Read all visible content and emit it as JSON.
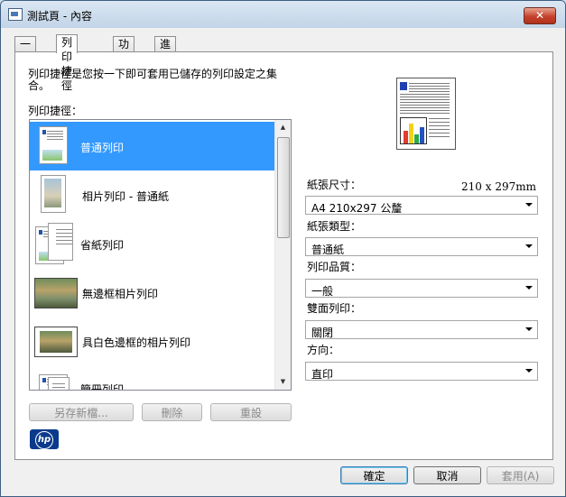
{
  "window": {
    "title": "測試頁 - 內容",
    "close_label": "✕"
  },
  "tabs": [
    {
      "label": "一般"
    },
    {
      "label": "列印捷徑"
    },
    {
      "label": "功能"
    },
    {
      "label": "進階"
    }
  ],
  "shortcuts": {
    "description": "列印捷徑是您按一下即可套用已儲存的列印設定之集合。",
    "list_label": "列印捷徑：",
    "items": [
      {
        "label": "普通列印",
        "selected": true
      },
      {
        "label": "相片列印 - 普通紙"
      },
      {
        "label": "省紙列印"
      },
      {
        "label": "無邊框相片列印"
      },
      {
        "label": "具白色邊框的相片列印"
      },
      {
        "label": "簡冊列印"
      }
    ],
    "buttons": {
      "save_as": "另存新檔...",
      "delete": "刪除",
      "reset": "重設"
    }
  },
  "settings": {
    "paper_size_label": "紙張尺寸：",
    "paper_size_dims": "210 x 297mm",
    "paper_size_value": "A4 210x297 公釐",
    "paper_type_label": "紙張類型：",
    "paper_type_value": "普通紙",
    "quality_label": "列印品質：",
    "quality_value": "一般",
    "duplex_label": "雙面列印：",
    "duplex_value": "關閉",
    "orientation_label": "方向：",
    "orientation_value": "直印"
  },
  "footer": {
    "ok": "確定",
    "cancel": "取消",
    "apply": "套用(A)"
  },
  "logo_text": "hp",
  "colors": {
    "selection": "#3399ff",
    "close_button": "#c4422d",
    "hp_blue": "#0a3a8c"
  }
}
